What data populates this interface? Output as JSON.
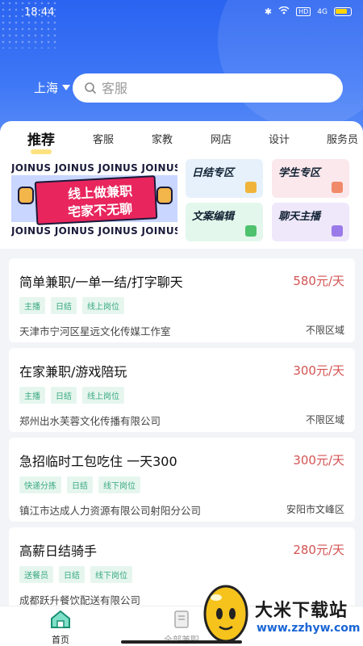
{
  "status": {
    "time": "18:44",
    "hd": "HD",
    "signal": "4G"
  },
  "header": {
    "city": "上海",
    "search_placeholder": "客服"
  },
  "tabs": [
    "推荐",
    "客服",
    "家教",
    "网店",
    "设计",
    "服务员"
  ],
  "banner": {
    "strip_text": "JOINUS JOINUS JOINUS JOINUS",
    "line1": "线上做兼职",
    "line2": "宅家不无聊"
  },
  "zones": [
    {
      "label": "日结专区",
      "bg": "#e6f1fb",
      "deco": "#f0b43a"
    },
    {
      "label": "学生专区",
      "bg": "#fbe8ec",
      "deco": "#f08a6a"
    },
    {
      "label": "文案编辑",
      "bg": "#e4f7ec",
      "deco": "#4fc26e"
    },
    {
      "label": "聊天主播",
      "bg": "#efe8fb",
      "deco": "#9a7ae8"
    }
  ],
  "jobs": [
    {
      "title": "简单兼职/一单一结/打字聊天",
      "price": "580元/天",
      "tags": [
        "主播",
        "日结",
        "线上岗位"
      ],
      "company": "天津市宁河区星远文化传媒工作室",
      "region": "不限区域"
    },
    {
      "title": "在家兼职/游戏陪玩",
      "price": "300元/天",
      "tags": [
        "主播",
        "日结",
        "线上岗位"
      ],
      "company": "郑州出水芙蓉文化传播有限公司",
      "region": "不限区域"
    },
    {
      "title": "急招临时工包吃住 一天300",
      "price": "300元/天",
      "tags": [
        "快递分拣",
        "日结",
        "线下岗位"
      ],
      "company": "镇江市达成人力资源有限公司射阳分公司",
      "region": "安阳市文峰区"
    },
    {
      "title": "高薪日结骑手",
      "price": "280元/天",
      "tags": [
        "送餐员",
        "日结",
        "线下岗位"
      ],
      "company": "成都跃升餐饮配送有限公司",
      "region": ""
    }
  ],
  "bottom_nav": [
    {
      "label": "首页",
      "icon": "home-icon",
      "active": true
    },
    {
      "label": "全部兼职",
      "icon": "list-icon",
      "active": false
    }
  ],
  "watermark": {
    "text": "大米下载站",
    "url": "www.zzhyw.com"
  },
  "colors": {
    "primary": "#3f78f6",
    "price": "#d45353",
    "tag_text": "#3aa982",
    "tag_bg": "#e6f6ef"
  }
}
